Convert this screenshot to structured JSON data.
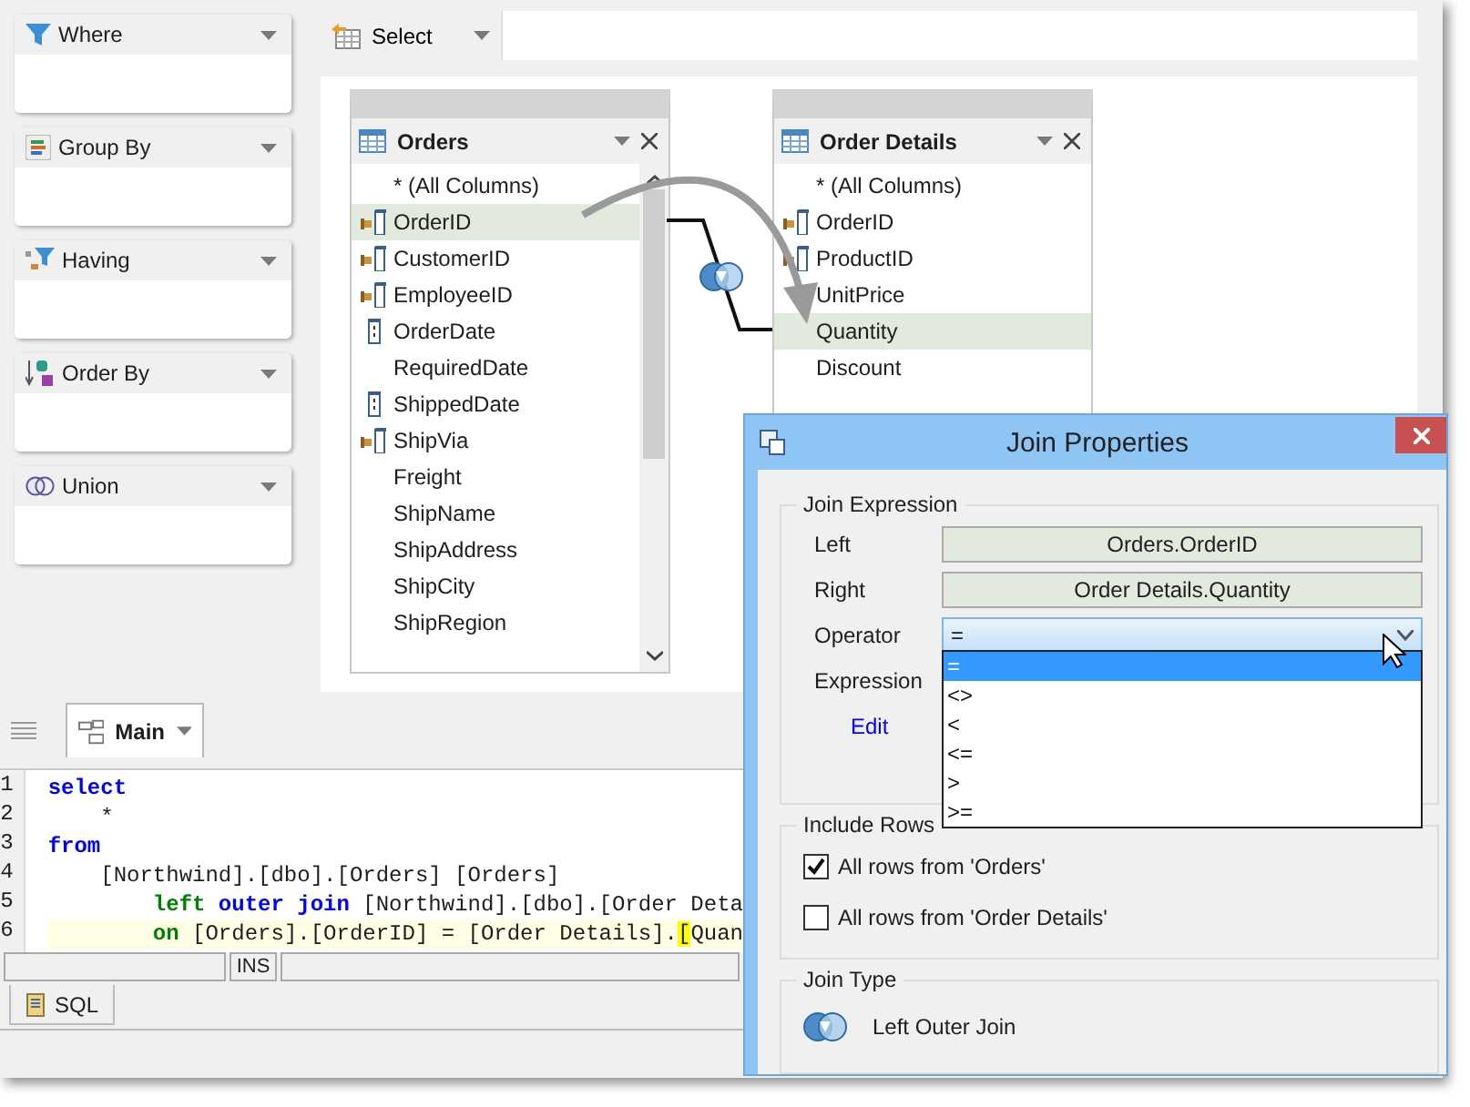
{
  "sidebar": {
    "panels": [
      {
        "kind": "where",
        "title": "Where"
      },
      {
        "kind": "group",
        "title": "Group By"
      },
      {
        "kind": "having",
        "title": "Having"
      },
      {
        "kind": "order",
        "title": "Order By"
      },
      {
        "kind": "union",
        "title": "Union"
      }
    ]
  },
  "toolbar": {
    "select_button": "Select"
  },
  "diagram": {
    "tables": [
      {
        "name": "Orders",
        "scrollable": true,
        "columns": [
          {
            "name": "* (All Columns)",
            "kind": "none",
            "selected": false
          },
          {
            "name": "OrderID",
            "kind": "key",
            "selected": true
          },
          {
            "name": "CustomerID",
            "kind": "key",
            "selected": false
          },
          {
            "name": "EmployeeID",
            "kind": "key",
            "selected": false
          },
          {
            "name": "OrderDate",
            "kind": "field",
            "selected": false
          },
          {
            "name": "RequiredDate",
            "kind": "none",
            "selected": false
          },
          {
            "name": "ShippedDate",
            "kind": "field",
            "selected": false
          },
          {
            "name": "ShipVia",
            "kind": "key",
            "selected": false
          },
          {
            "name": "Freight",
            "kind": "none",
            "selected": false
          },
          {
            "name": "ShipName",
            "kind": "none",
            "selected": false
          },
          {
            "name": "ShipAddress",
            "kind": "none",
            "selected": false
          },
          {
            "name": "ShipCity",
            "kind": "none",
            "selected": false
          },
          {
            "name": "ShipRegion",
            "kind": "none",
            "selected": false
          }
        ]
      },
      {
        "name": "Order Details",
        "scrollable": false,
        "columns": [
          {
            "name": "* (All Columns)",
            "kind": "none",
            "selected": false
          },
          {
            "name": "OrderID",
            "kind": "key",
            "selected": false
          },
          {
            "name": "ProductID",
            "kind": "key",
            "selected": false
          },
          {
            "name": "UnitPrice",
            "kind": "none",
            "selected": false
          },
          {
            "name": "Quantity",
            "kind": "none",
            "selected": true
          },
          {
            "name": "Discount",
            "kind": "none",
            "selected": false
          }
        ]
      }
    ]
  },
  "query_tabs": [
    {
      "label": "Main",
      "selected": true
    }
  ],
  "editor": {
    "lines": [
      {
        "number": "1",
        "current": false,
        "tokens": [
          {
            "kind": "keyword",
            "text": "select"
          }
        ]
      },
      {
        "number": "2",
        "current": false,
        "tokens": [
          {
            "kind": "plain",
            "text": "    *"
          }
        ]
      },
      {
        "number": "3",
        "current": false,
        "tokens": [
          {
            "kind": "keyword",
            "text": "from"
          }
        ]
      },
      {
        "number": "4",
        "current": false,
        "tokens": [
          {
            "kind": "plain",
            "text": "    [Northwind].[dbo].[Orders] [Orders]"
          }
        ]
      },
      {
        "number": "5",
        "current": false,
        "tokens": [
          {
            "kind": "join",
            "text": "        left"
          },
          {
            "kind": "keyword",
            "text": " outer join"
          },
          {
            "kind": "plain",
            "text": " [Northwind].[dbo].[Order Deta"
          }
        ]
      },
      {
        "number": "6",
        "current": true,
        "tokens": [
          {
            "kind": "join",
            "text": "        on"
          },
          {
            "kind": "plain",
            "text": " [Orders].[OrderID] = [Order Details]."
          },
          {
            "kind": "match",
            "text": "["
          },
          {
            "kind": "plain",
            "text": "Quan"
          }
        ]
      }
    ]
  },
  "status_bar": {
    "mode": "INS"
  },
  "bottom_tabs": [
    {
      "label": "SQL",
      "selected": true
    }
  ],
  "dialog": {
    "title": "Join Properties",
    "join_expression": {
      "legend": "Join Expression",
      "left_label": "Left",
      "left_value": "Orders.OrderID",
      "right_label": "Right",
      "right_value": "Order Details.Quantity",
      "operator_label": "Operator",
      "operator_value": "=",
      "operator_options": [
        {
          "label": "=",
          "selected": true
        },
        {
          "label": "<>",
          "selected": false
        },
        {
          "label": "<",
          "selected": false
        },
        {
          "label": "<=",
          "selected": false
        },
        {
          "label": ">",
          "selected": false
        },
        {
          "label": ">=",
          "selected": false
        }
      ],
      "expression_label": "Expression",
      "edit_link": "Edit"
    },
    "include_rows": {
      "legend": "Include Rows",
      "options": [
        {
          "label": "All rows from 'Orders'",
          "checked": true
        },
        {
          "label": "All rows from 'Order Details'",
          "checked": false
        }
      ]
    },
    "join_type": {
      "legend": "Join Type",
      "value": "Left Outer Join"
    }
  }
}
